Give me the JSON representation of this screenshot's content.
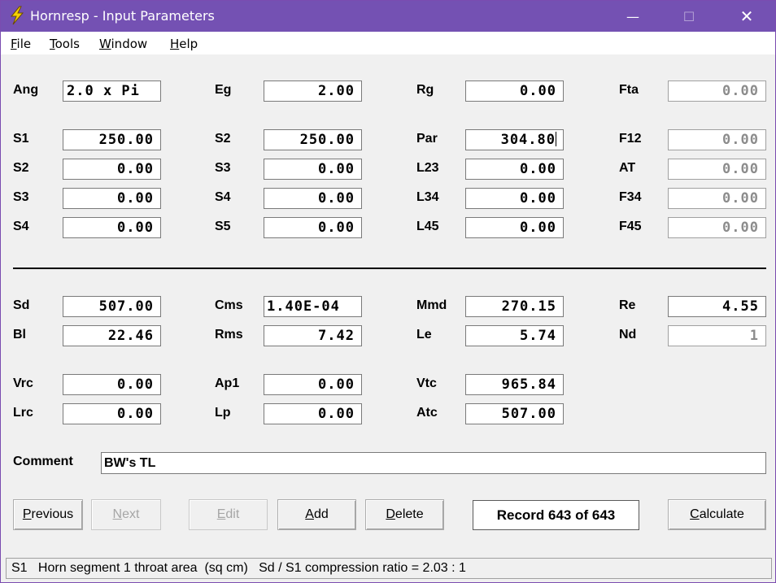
{
  "window": {
    "title": "Hornresp - Input Parameters",
    "minimize_glyph": "—",
    "maximize_glyph": "☐",
    "close_glyph": "✕"
  },
  "menu": [
    {
      "mnemonic": "F",
      "rest": "ile"
    },
    {
      "mnemonic": "T",
      "rest": "ools"
    },
    {
      "mnemonic": "W",
      "rest": "indow"
    },
    {
      "mnemonic": "H",
      "rest": "elp"
    }
  ],
  "fields": {
    "ang": {
      "label": "Ang",
      "value": "2.0 x Pi"
    },
    "eg": {
      "label": "Eg",
      "value": "2.00"
    },
    "rg": {
      "label": "Rg",
      "value": "0.00"
    },
    "fta": {
      "label": "Fta",
      "value": "0.00"
    },
    "s1": {
      "label": "S1",
      "value": "250.00"
    },
    "s2b": {
      "label": "S2",
      "value": "250.00"
    },
    "par": {
      "label": "Par",
      "value": "304.80"
    },
    "f12": {
      "label": "F12",
      "value": "0.00"
    },
    "s2": {
      "label": "S2",
      "value": "0.00"
    },
    "s3b": {
      "label": "S3",
      "value": "0.00"
    },
    "l23": {
      "label": "L23",
      "value": "0.00"
    },
    "at": {
      "label": "AT",
      "value": "0.00"
    },
    "s3": {
      "label": "S3",
      "value": "0.00"
    },
    "s4b": {
      "label": "S4",
      "value": "0.00"
    },
    "l34": {
      "label": "L34",
      "value": "0.00"
    },
    "f34": {
      "label": "F34",
      "value": "0.00"
    },
    "s4": {
      "label": "S4",
      "value": "0.00"
    },
    "s5": {
      "label": "S5",
      "value": "0.00"
    },
    "l45": {
      "label": "L45",
      "value": "0.00"
    },
    "f45": {
      "label": "F45",
      "value": "0.00"
    },
    "sd": {
      "label": "Sd",
      "value": "507.00"
    },
    "cms": {
      "label": "Cms",
      "value": "1.40E-04"
    },
    "mmd": {
      "label": "Mmd",
      "value": "270.15"
    },
    "re": {
      "label": "Re",
      "value": "4.55"
    },
    "bl": {
      "label": "Bl",
      "value": "22.46"
    },
    "rms": {
      "label": "Rms",
      "value": "7.42"
    },
    "le": {
      "label": "Le",
      "value": "5.74"
    },
    "nd": {
      "label": "Nd",
      "value": "1"
    },
    "vrc": {
      "label": "Vrc",
      "value": "0.00"
    },
    "ap1": {
      "label": "Ap1",
      "value": "0.00"
    },
    "vtc": {
      "label": "Vtc",
      "value": "965.84"
    },
    "lrc": {
      "label": "Lrc",
      "value": "0.00"
    },
    "lp": {
      "label": "Lp",
      "value": "0.00"
    },
    "atc": {
      "label": "Atc",
      "value": "507.00"
    }
  },
  "comment": {
    "label": "Comment",
    "value": "BW's TL"
  },
  "buttons": {
    "previous": {
      "mnemonic": "P",
      "rest": "revious"
    },
    "next": {
      "mnemonic": "N",
      "rest": "ext"
    },
    "edit": {
      "mnemonic": "E",
      "rest": "dit"
    },
    "add": {
      "mnemonic": "A",
      "rest": "dd"
    },
    "delete": {
      "mnemonic": "D",
      "rest": "elete"
    },
    "calculate": {
      "mnemonic": "C",
      "rest": "alculate"
    }
  },
  "record": "Record 643 of 643",
  "status": "S1   Horn segment 1 throat area  (sq cm)   Sd / S1 compression ratio = 2.03 : 1",
  "colors": {
    "titlebar": "#7451b3",
    "icon_bolt": "#f5d000",
    "disabled_text": "#8c8c8c"
  },
  "icons": {
    "app": "lightning-bolt-icon"
  }
}
